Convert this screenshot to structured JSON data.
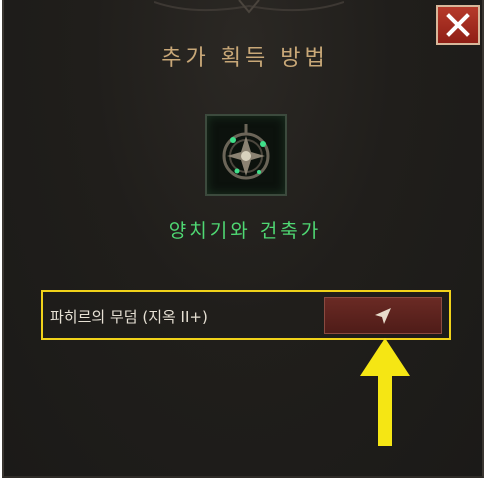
{
  "dialog": {
    "title": "추가 획득 방법",
    "item_name": "양치기와 건축가",
    "close_icon": "close-icon"
  },
  "sources": [
    {
      "label": "파히르의 무덤 (지옥 II+)",
      "action_icon": "navigate-arrow-icon"
    }
  ],
  "colors": {
    "close_button": "#a8301f",
    "highlight_border": "#f0d21a",
    "item_name": "#4fd873",
    "title": "#c9a878",
    "annotation_arrow": "#f5e614"
  }
}
